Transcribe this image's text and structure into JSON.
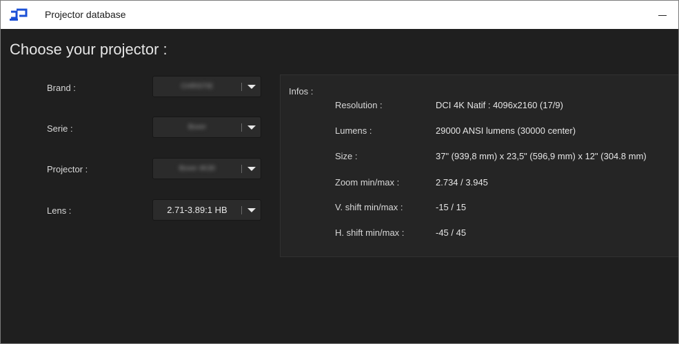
{
  "window": {
    "title": "Projector database",
    "icon": "app-logo-icon",
    "accent_color": "#1a4fd6",
    "minimize_icon": "minimize-icon"
  },
  "heading": "Choose your projector :",
  "fields": {
    "brand": {
      "label": "Brand :",
      "value": "CHRISTIE"
    },
    "serie": {
      "label": "Serie :",
      "value": "Boxer"
    },
    "projector": {
      "label": "Projector :",
      "value": "Boxer 4K30"
    },
    "lens": {
      "label": "Lens :",
      "value": "2.71-3.89:1 HB"
    }
  },
  "infos": {
    "title": "Infos :",
    "rows": [
      {
        "key": "Resolution :",
        "value": "DCI 4K Natif : 4096x2160 (17/9)"
      },
      {
        "key": "Lumens :",
        "value": "29000 ANSI lumens (30000 center)"
      },
      {
        "key": "Size :",
        "value": "37\" (939,8 mm) x 23,5\" (596,9 mm) x 12\" (304.8 mm)"
      },
      {
        "key": "Zoom min/max :",
        "value": "2.734 / 3.945"
      },
      {
        "key": "V. shift min/max :",
        "value": "-15 / 15"
      },
      {
        "key": "H. shift min/max :",
        "value": "-45 / 45"
      }
    ]
  }
}
